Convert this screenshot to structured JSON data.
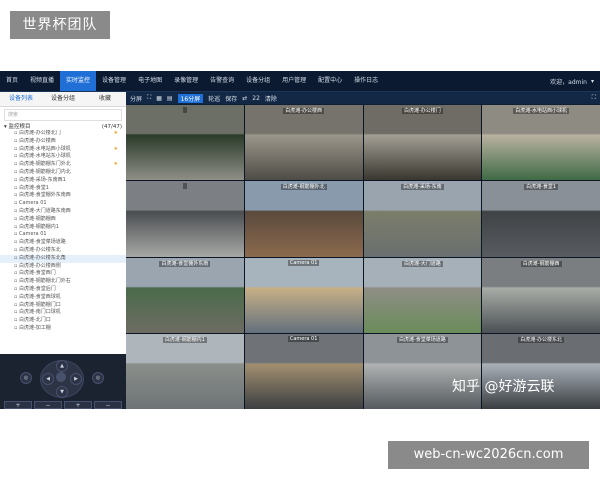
{
  "badge": {
    "title": "世界杯团队"
  },
  "topnav": {
    "items": [
      {
        "label": "首页",
        "active": false
      },
      {
        "label": "视频直播",
        "active": false
      },
      {
        "label": "实时监控",
        "active": true
      },
      {
        "label": "设备管理",
        "active": false
      },
      {
        "label": "电子地图",
        "active": false
      },
      {
        "label": "录像管理",
        "active": false
      },
      {
        "label": "告警查询",
        "active": false
      },
      {
        "label": "设备分组",
        "active": false
      },
      {
        "label": "用户管理",
        "active": false
      },
      {
        "label": "配置中心",
        "active": false
      },
      {
        "label": "操作日志",
        "active": false
      }
    ],
    "user": "欢迎，admin"
  },
  "sidebar": {
    "tabs": [
      "设备列表",
      "设备分组",
      "收藏"
    ],
    "search_placeholder": "搜索",
    "tree_root": "监控根目",
    "tree_count": "(47/47)",
    "items": [
      {
        "label": "白虎滩-办公楼北门",
        "star": true
      },
      {
        "label": "白虎滩-办公楼西"
      },
      {
        "label": "白虎滩-水电站西小球机",
        "star": true
      },
      {
        "label": "白虎滩-水电站东小球机"
      },
      {
        "label": "白虎滩-钢筋棚东门外北",
        "star": true
      },
      {
        "label": "白虎滩-钢筋棚北门内北"
      },
      {
        "label": "白虎滩-采场-东南西1"
      },
      {
        "label": "白虎滩-食堂1"
      },
      {
        "label": "白虎滩-食堂棚外东南西"
      },
      {
        "label": "Camera 01"
      },
      {
        "label": "白虎滩-大门道路东南西"
      },
      {
        "label": "白虎滩-钢筋棚西"
      },
      {
        "label": "白虎滩-钢筋棚内1"
      },
      {
        "label": "Camera 01"
      },
      {
        "label": "白虎滩-食堂菜场道路"
      },
      {
        "label": "白虎滩-办公楼东北"
      },
      {
        "label": "白虎滩-办公楼东北角",
        "sel": true
      },
      {
        "label": "白虎滩-办公楼西侧"
      },
      {
        "label": "白虎滩-食堂西门"
      },
      {
        "label": "白虎滩-钢筋棚北门外右"
      },
      {
        "label": "白虎滩-食堂后门"
      },
      {
        "label": "白虎滩-食堂西球机"
      },
      {
        "label": "白虎滩-钢筋棚门口"
      },
      {
        "label": "白虎滩-南门口球机"
      },
      {
        "label": "白虎滩-北门口"
      },
      {
        "label": "白虎滩-加工棚"
      }
    ]
  },
  "ptz": {
    "buttons_row": [
      "+",
      "−",
      "+",
      "−"
    ],
    "slider_value": 100,
    "slider_max": 100
  },
  "toolbar": {
    "split_label": "分屏",
    "split_option": "16分屏",
    "poll_label": "轮巡",
    "save_label": "保存",
    "interval": "22",
    "close_label": "清除"
  },
  "cameras": [
    {
      "label": "",
      "palette": [
        "#6b6f66",
        "#8e8f87",
        "#2b3b2a"
      ]
    },
    {
      "label": "白虎滩-办公楼西",
      "palette": [
        "#75736c",
        "#4e4c46",
        "#9b968a"
      ]
    },
    {
      "label": "白虎滩-办公楼门",
      "palette": [
        "#6f6c65",
        "#38372f",
        "#a39f95"
      ]
    },
    {
      "label": "白虎滩-水电站西小球机",
      "palette": [
        "#8e8b82",
        "#3f6a46",
        "#b9b2a0"
      ]
    },
    {
      "label": "",
      "palette": [
        "#7c7f83",
        "#a7a9a7",
        "#4b4e51"
      ]
    },
    {
      "label": "白虎滩-钢筋棚外北",
      "palette": [
        "#889aab",
        "#8c6a4e",
        "#5a4a3c"
      ]
    },
    {
      "label": "白虎滩-采场-东南",
      "palette": [
        "#9aa4ae",
        "#6a6f70",
        "#7b7e6a"
      ]
    },
    {
      "label": "白虎滩-食堂1",
      "palette": [
        "#8a9098",
        "#585c60",
        "#3f4346"
      ]
    },
    {
      "label": "白虎滩-食堂棚外东南",
      "palette": [
        "#9aa5b0",
        "#6e6c63",
        "#4a6b4a"
      ]
    },
    {
      "label": "Camera 01",
      "palette": [
        "#a8b4bd",
        "#64707c",
        "#c7b087"
      ]
    },
    {
      "label": "白虎滩-大门道路",
      "palette": [
        "#a6b0b9",
        "#6a8c5a",
        "#8f8e86"
      ]
    },
    {
      "label": "白虎滩-钢筋棚西",
      "palette": [
        "#7a7e80",
        "#4b5154",
        "#a8aca7"
      ]
    },
    {
      "label": "白虎滩-钢筋棚内1",
      "palette": [
        "#aeb6bc",
        "#6e7377",
        "#8a8f8a"
      ]
    },
    {
      "label": "Camera 01",
      "palette": [
        "#6f7378",
        "#3c3f42",
        "#a28f70"
      ]
    },
    {
      "label": "白虎滩-食堂菜场道路",
      "palette": [
        "#8e9398",
        "#545a5f",
        "#b0b3b2"
      ]
    },
    {
      "label": "白虎滩-办公楼东北",
      "palette": [
        "#6a6e72",
        "#3a3e42",
        "#a9b0b8"
      ]
    }
  ],
  "watermark": "知乎 @好游云联",
  "footer_badge": "web-cn-wc2026cn.com"
}
